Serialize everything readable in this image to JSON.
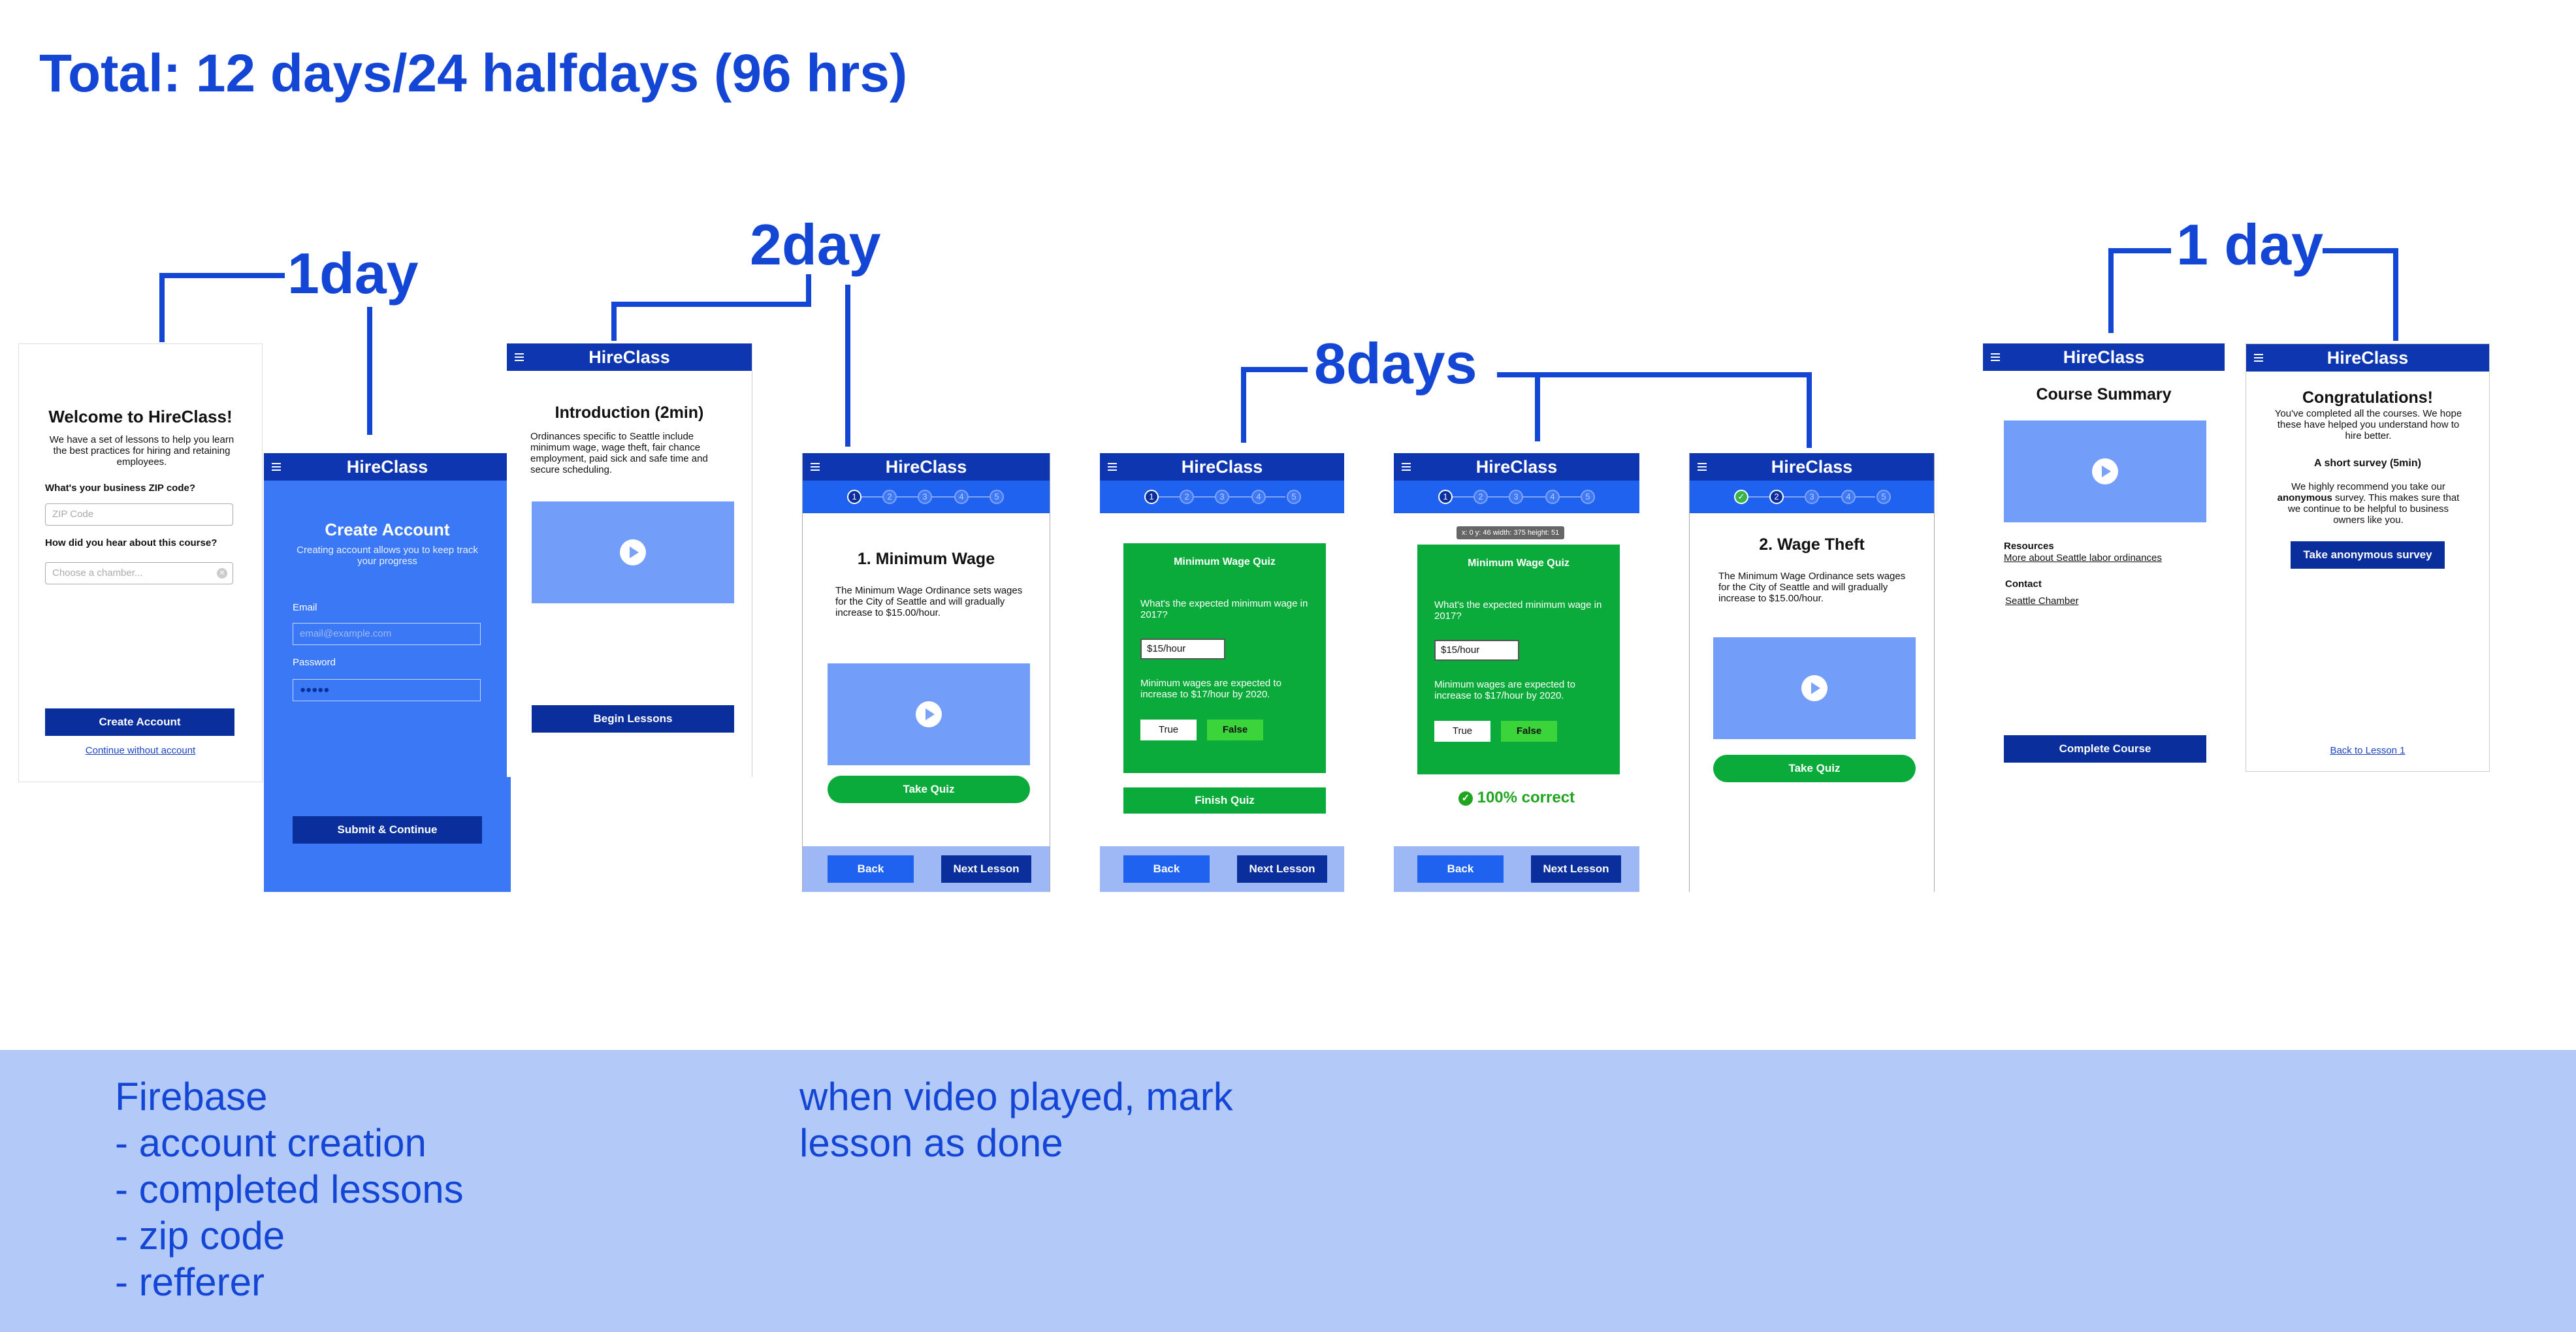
{
  "page_title": "Total: 12 days/24 halfdays (96 hrs)",
  "estimates": {
    "onboarding": "1day",
    "intro": "2day",
    "lessons": "8days",
    "wrapup": "1 day"
  },
  "notes": {
    "firebase": [
      "Firebase",
      "- account creation",
      "- completed lessons",
      "- zip code",
      "- refferer"
    ],
    "video": [
      "when video played, mark",
      "lesson as done"
    ]
  },
  "app_name": "HireClass",
  "welcome": {
    "title": "Welcome to HireClass!",
    "desc": "We have a set of lessons to help you learn the best practices for hiring and retaining employees.",
    "zip_label": "What's your business ZIP code?",
    "zip_placeholder": "ZIP Code",
    "hear_label": "How did you hear about this course?",
    "hear_placeholder": "Choose a chamber...",
    "create_button": "Create Account",
    "skip_link": "Continue without account"
  },
  "create": {
    "title": "Create Account",
    "desc": "Creating account allows you to keep track your progress",
    "email_label": "Email",
    "email_placeholder": "email@example.com",
    "password_label": "Password",
    "password_value": "●●●●●",
    "submit_button": "Submit & Continue"
  },
  "intro": {
    "title": "Introduction (2min)",
    "desc": "Ordinances specific to Seattle include minimum wage, wage theft, fair chance employment, paid sick and safe time and secure scheduling.",
    "begin_button": "Begin Lessons"
  },
  "steps": [
    "1",
    "2",
    "3",
    "4",
    "5"
  ],
  "lesson1": {
    "title": "1. Minimum Wage",
    "desc": "The Minimum Wage Ordinance sets wages for the City of Seattle and will gradually increase to $15.00/hour.",
    "quiz_button": "Take Quiz"
  },
  "nav": {
    "back": "Back",
    "next": "Next Lesson"
  },
  "quiz": {
    "title": "Minimum Wage Quiz",
    "q1": "What's the expected minimum wage in 2017?",
    "answer": "$15/hour",
    "q2": "Minimum wages are expected to increase to $17/hour by 2020.",
    "true_label": "True",
    "false_label": "False",
    "finish_button": "Finish Quiz",
    "result": "100% correct",
    "dev_tooltip": "x: 0  y: 46  width: 375  height: 51"
  },
  "lesson2": {
    "title": "2. Wage Theft",
    "desc": "The Minimum Wage Ordinance sets wages for the City of Seattle and will gradually increase to $15.00/hour.",
    "quiz_button": "Take Quiz"
  },
  "summary": {
    "title": "Course Summary",
    "resources_label": "Resources",
    "resources_link": "More about Seattle labor ordinances",
    "contact_label": "Contact",
    "contact_link": "Seattle Chamber",
    "complete_button": "Complete Course"
  },
  "congrats": {
    "title": "Congratulations!",
    "desc": "You've completed all the courses. We hope these have helped you understand how to hire better.",
    "survey_title": "A short survey (5min)",
    "survey_pre": "We highly recommend you take our",
    "survey_bold": "anonymous",
    "survey_post": "survey. This makes sure that we continue to be helpful to business owners like you.",
    "survey_button": "Take anonymous survey",
    "back_link": "Back to Lesson 1"
  },
  "colors": {
    "accent": "#1446d6",
    "header": "#0d36b0",
    "success": "#0aab3b"
  }
}
